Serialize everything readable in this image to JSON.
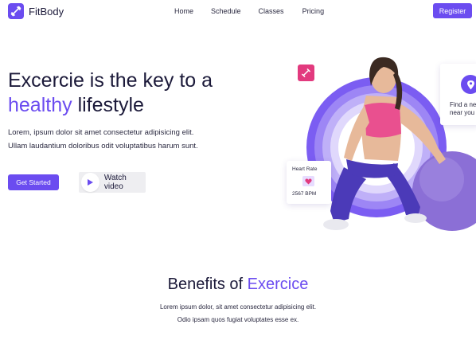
{
  "brand": {
    "name": "FitBody",
    "accent": "#6b4cf0",
    "badge_color": "#e23a7e"
  },
  "nav": {
    "items": [
      {
        "label": "Home"
      },
      {
        "label": "Schedule"
      },
      {
        "label": "Classes"
      },
      {
        "label": "Pricing"
      }
    ],
    "register_label": "Register"
  },
  "hero": {
    "title_part1": "Excercie is the key to a",
    "title_accent": "healthy",
    "title_part2": " lifestyle",
    "desc_line1": "Lorem, ipsum dolor sit amet consectetur adipisicing elit.",
    "desc_line2": "Ullam laudantium doloribus odit voluptatibus harum sunt.",
    "get_started_label": "Get Started",
    "watch_video_label": "Watch video",
    "heart_card": {
      "title": "Heart Rate",
      "value": "2567 BPM"
    },
    "find_card": {
      "line1": "Find a new",
      "line2": "near you"
    },
    "image_alt": "Woman in pink sports top posing with purple exercise ball"
  },
  "benefits": {
    "title_part1": "Benefits of ",
    "title_accent": "Exercice",
    "desc_line1": "Lorem ipsum dolor, sit amet consectetur adipisicing elit.",
    "desc_line2": "Odio ipsam quos fugiat voluptates esse ex."
  },
  "icons": [
    "dumbbell-icon",
    "play-icon",
    "heart-icon",
    "location-pin-icon"
  ]
}
